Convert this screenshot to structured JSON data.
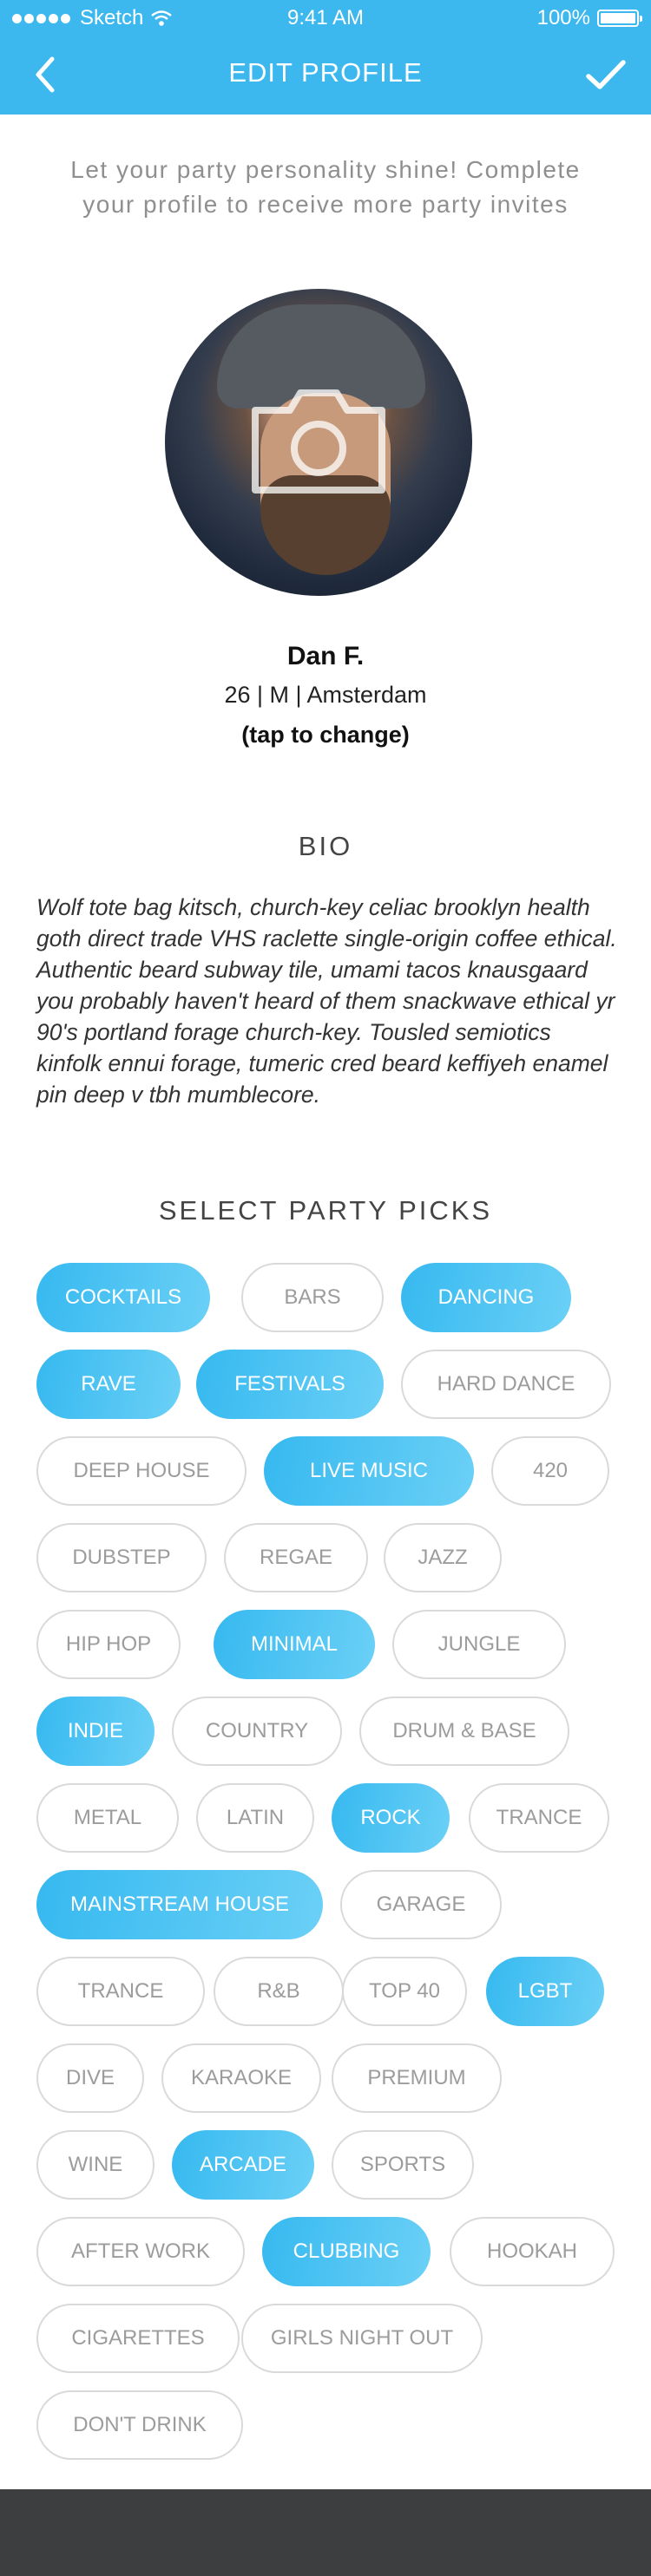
{
  "status_bar": {
    "carrier": "Sketch",
    "time": "9:41 AM",
    "battery": "100%"
  },
  "nav": {
    "title": "EDIT PROFILE"
  },
  "intro_text": "Let your party personality shine! Complete your profile to receive more party invites",
  "profile": {
    "name": "Dan F.",
    "meta": "26 | M | Amsterdam",
    "change_label": "(tap to change)"
  },
  "bio": {
    "title": "BIO",
    "text": "Wolf tote bag kitsch, church-key celiac brooklyn health goth direct trade VHS raclette single-origin coffee ethical. Authentic beard subway tile, umami tacos knausgaard you probably haven't heard of them snackwave ethical yr 90's portland forage church-key. Tousled semiotics kinfolk ennui forage, tumeric cred beard keffiyeh enamel pin deep v tbh mumblecore."
  },
  "picks": {
    "title": "SELECT PARTY PICKS",
    "items": [
      {
        "label": "COCKTAILS",
        "selected": true
      },
      {
        "label": "BARS",
        "selected": false
      },
      {
        "label": "DANCING",
        "selected": true
      },
      {
        "label": "RAVE",
        "selected": true
      },
      {
        "label": "FESTIVALS",
        "selected": true
      },
      {
        "label": "HARD DANCE",
        "selected": false
      },
      {
        "label": "DEEP HOUSE",
        "selected": false
      },
      {
        "label": "LIVE MUSIC",
        "selected": true
      },
      {
        "label": "420",
        "selected": false
      },
      {
        "label": "DUBSTEP",
        "selected": false
      },
      {
        "label": "REGAE",
        "selected": false
      },
      {
        "label": "JAZZ",
        "selected": false
      },
      {
        "label": "HIP HOP",
        "selected": false
      },
      {
        "label": "MINIMAL",
        "selected": true
      },
      {
        "label": "JUNGLE",
        "selected": false
      },
      {
        "label": "INDIE",
        "selected": true
      },
      {
        "label": "COUNTRY",
        "selected": false
      },
      {
        "label": "DRUM & BASE",
        "selected": false
      },
      {
        "label": "METAL",
        "selected": false
      },
      {
        "label": "LATIN",
        "selected": false
      },
      {
        "label": "ROCK",
        "selected": true
      },
      {
        "label": "TRANCE",
        "selected": false
      },
      {
        "label": "MAINSTREAM HOUSE",
        "selected": true
      },
      {
        "label": "GARAGE",
        "selected": false
      },
      {
        "label": "TRANCE",
        "selected": false
      },
      {
        "label": "R&B",
        "selected": false
      },
      {
        "label": "TOP 40",
        "selected": false
      },
      {
        "label": "LGBT",
        "selected": true
      },
      {
        "label": "DIVE",
        "selected": false
      },
      {
        "label": "KARAOKE",
        "selected": false
      },
      {
        "label": "PREMIUM",
        "selected": false
      },
      {
        "label": "WINE",
        "selected": false
      },
      {
        "label": "ARCADE",
        "selected": true
      },
      {
        "label": "SPORTS",
        "selected": false
      },
      {
        "label": "AFTER WORK",
        "selected": false
      },
      {
        "label": "CLUBBING",
        "selected": true
      },
      {
        "label": "HOOKAH",
        "selected": false
      },
      {
        "label": "CIGARETTES",
        "selected": false
      },
      {
        "label": "GIRLS NIGHT OUT",
        "selected": false
      },
      {
        "label": "DON'T DRINK",
        "selected": false
      }
    ]
  },
  "colors": {
    "accent": "#3cb8ef",
    "footer": "#3d3e40"
  }
}
